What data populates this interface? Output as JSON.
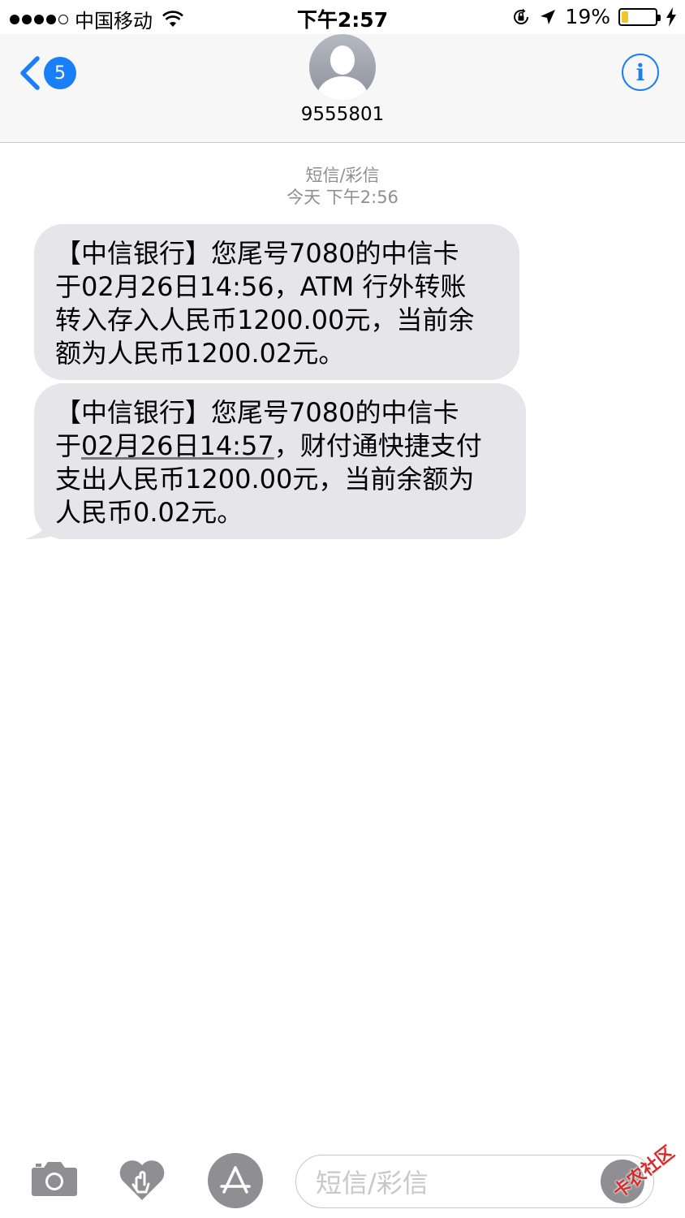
{
  "status_bar": {
    "carrier": "中国移动",
    "time": "下午2:57",
    "battery_percent": "19%",
    "battery_level": 0.19,
    "signal_bars_filled": 4,
    "signal_bars_total": 5,
    "icons": [
      "wifi-icon",
      "rotation-lock-icon",
      "location-arrow-icon",
      "battery-icon",
      "charging-bolt-icon"
    ]
  },
  "header": {
    "back_badge": "5",
    "contact_name": "9555801",
    "accent_color": "#1a7ef7",
    "icons": [
      "back-chevron-icon",
      "contact-avatar-icon",
      "info-icon"
    ]
  },
  "thread": {
    "service_label": "短信/彩信",
    "timestamp": "今天 下午2:56",
    "messages": [
      {
        "line1": "【中信银行】您尾号7080的中信卡",
        "line2": "于02月26日14:56，ATM 行外转账",
        "line3": "转入存入人民币1200.00元，当前余",
        "line4": "额为人民币1200.02元。"
      },
      {
        "line1": "【中信银行】您尾号7080的中信卡",
        "line2_prefix": "于",
        "line2_link": "02月26日14:57",
        "line2_suffix": "，财付通快捷支付",
        "line3": "支出人民币1200.00元，当前余额为",
        "line4": "人民币0.02元。"
      }
    ],
    "bubble_color": "#e5e5ea"
  },
  "input_bar": {
    "placeholder": "短信/彩信",
    "icons": [
      "camera-icon",
      "digital-touch-icon",
      "app-store-icon",
      "microphone-icon"
    ]
  },
  "watermark": {
    "text": "卡农社区"
  }
}
